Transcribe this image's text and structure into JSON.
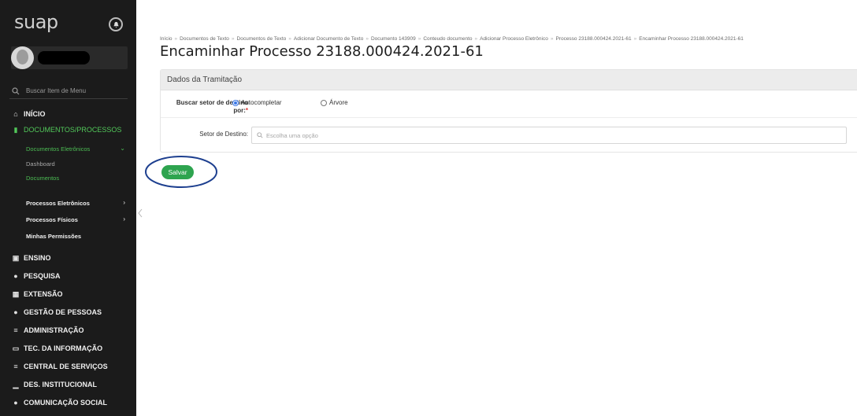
{
  "app": {
    "logo_text": "suap"
  },
  "sidebar": {
    "search_placeholder": "Buscar Item de Menu",
    "items": [
      {
        "label": "INÍCIO",
        "icon": "home-icon"
      },
      {
        "label": "DOCUMENTOS/PROCESSOS",
        "icon": "folder-icon",
        "active": true
      },
      {
        "label": "ENSINO",
        "icon": "board-icon"
      },
      {
        "label": "PESQUISA",
        "icon": "globe-icon"
      },
      {
        "label": "EXTENSÃO",
        "icon": "chart-icon"
      },
      {
        "label": "GESTÃO DE PESSOAS",
        "icon": "people-icon"
      },
      {
        "label": "ADMINISTRAÇÃO",
        "icon": "list-icon"
      },
      {
        "label": "TEC. DA INFORMAÇÃO",
        "icon": "monitor-icon"
      },
      {
        "label": "CENTRAL DE SERVIÇOS",
        "icon": "menu-icon"
      },
      {
        "label": "DES. INSTITUCIONAL",
        "icon": "bar-chart-icon"
      },
      {
        "label": "COMUNICAÇÃO SOCIAL",
        "icon": "speech-icon"
      }
    ],
    "sub_items": {
      "documentos_eletronicos": "Documentos Eletrônicos",
      "dashboard": "Dashboard",
      "documentos": "Documentos",
      "processos_eletronicos": "Processos Eletrônicos",
      "processos_fisicos": "Processos Físicos",
      "minhas_permissoes": "Minhas Permissões"
    }
  },
  "breadcrumb": {
    "items": [
      "Início",
      "Documentos de Texto",
      "Documentos de Texto",
      "Adicionar Documento de Texto",
      "Documento 143909",
      "Conteudo documento",
      "Adicionar Processo Eletrônico",
      "Processo 23188.000424.2021-61",
      "Encaminhar Processo 23188.000424.2021-61"
    ],
    "separator": "»"
  },
  "page": {
    "title": "Encaminhar Processo 23188.000424.2021-61"
  },
  "form": {
    "panel_title": "Dados da Tramitação",
    "search_by_label_line1": "Buscar setor de destino",
    "search_by_label_line2": "por:",
    "required_mark": "*",
    "radio_autocomplete": "Autocompletar",
    "radio_tree": "Árvore",
    "selected_option": "Autocompletar",
    "destination_label": "Setor de Destino:",
    "destination_placeholder": "Escolha uma opção",
    "save_label": "Salvar"
  },
  "colors": {
    "sidebar_bg": "#1b1b1b",
    "active_green": "#4cbd54",
    "save_button": "#2ea44f",
    "annotation_circle": "#1d3f8f"
  }
}
